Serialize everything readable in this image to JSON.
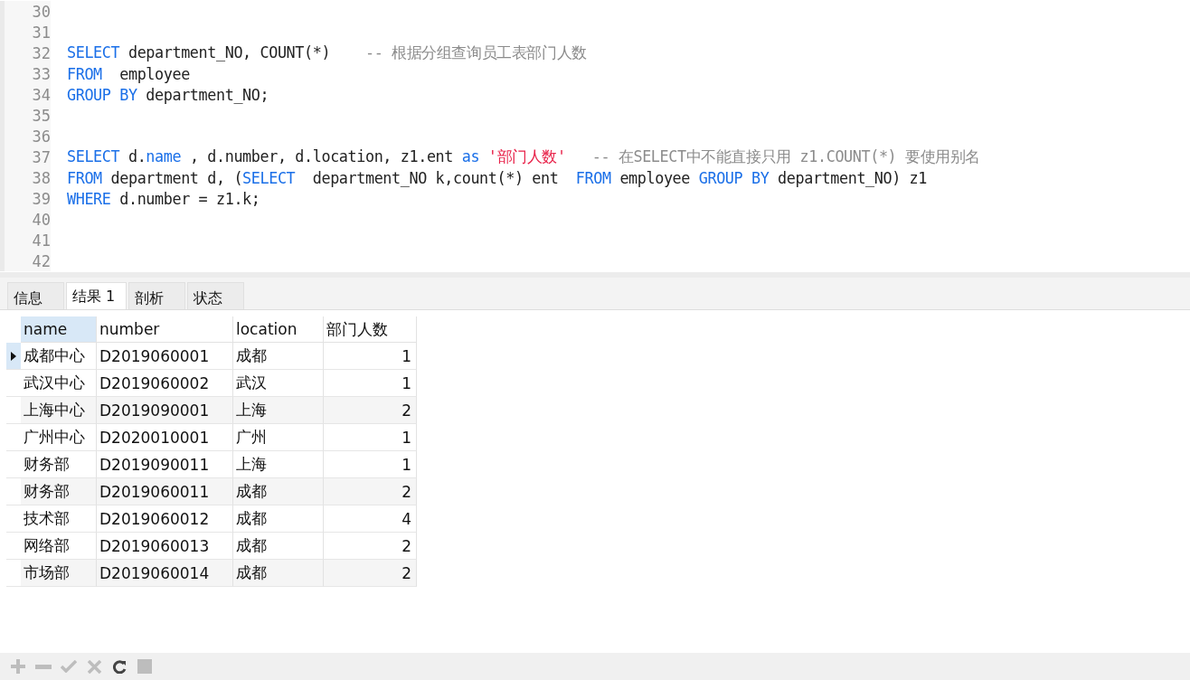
{
  "editor": {
    "lines": [
      {
        "number": "30"
      },
      {
        "number": "31"
      },
      {
        "number": "32",
        "tokens": [
          {
            "kind": "keyword",
            "text": "SELECT"
          },
          {
            "kind": "plain",
            "text": " department_NO, COUNT(*)    "
          },
          {
            "kind": "comment",
            "text": "-- 根据分组查询员工表部门人数"
          }
        ]
      },
      {
        "number": "33",
        "tokens": [
          {
            "kind": "keyword",
            "text": "FROM"
          },
          {
            "kind": "plain",
            "text": "  employee"
          }
        ]
      },
      {
        "number": "34",
        "tokens": [
          {
            "kind": "keyword",
            "text": "GROUP BY"
          },
          {
            "kind": "plain",
            "text": " department_NO;"
          }
        ]
      },
      {
        "number": "35"
      },
      {
        "number": "36"
      },
      {
        "number": "37",
        "tokens": [
          {
            "kind": "keyword",
            "text": "SELECT"
          },
          {
            "kind": "plain",
            "text": " d."
          },
          {
            "kind": "keyword",
            "text": "name"
          },
          {
            "kind": "plain",
            "text": " , d.number, d.location, z1.ent "
          },
          {
            "kind": "keyword",
            "text": "as"
          },
          {
            "kind": "string",
            "text": " '部门人数'"
          },
          {
            "kind": "comment",
            "text": "   -- 在SELECT中不能直接只用 z1.COUNT(*) 要使用别名"
          }
        ]
      },
      {
        "number": "38",
        "tokens": [
          {
            "kind": "keyword",
            "text": "FROM"
          },
          {
            "kind": "plain",
            "text": " department d, ("
          },
          {
            "kind": "keyword",
            "text": "SELECT"
          },
          {
            "kind": "plain",
            "text": "  department_NO k,count(*) ent  "
          },
          {
            "kind": "keyword",
            "text": "FROM"
          },
          {
            "kind": "plain",
            "text": " employee "
          },
          {
            "kind": "keyword",
            "text": "GROUP BY"
          },
          {
            "kind": "plain",
            "text": " department_NO) z1"
          }
        ]
      },
      {
        "number": "39",
        "tokens": [
          {
            "kind": "keyword",
            "text": "WHERE"
          },
          {
            "kind": "plain",
            "text": " d.number = z1.k;"
          }
        ]
      },
      {
        "number": "40"
      },
      {
        "number": "41"
      },
      {
        "number": "42"
      }
    ]
  },
  "tabs": [
    {
      "label": "信息",
      "selected": false
    },
    {
      "label": "结果 1",
      "selected": true
    },
    {
      "label": "剖析",
      "selected": false
    },
    {
      "label": "状态",
      "selected": false
    }
  ],
  "grid": {
    "columns": [
      {
        "label": "name",
        "kind": "text",
        "selected": true
      },
      {
        "label": "number",
        "kind": "text",
        "selected": false
      },
      {
        "label": "location",
        "kind": "text",
        "selected": false
      },
      {
        "label": "部门人数",
        "kind": "numeric",
        "selected": false
      }
    ],
    "rows": [
      {
        "current": true,
        "cells": [
          "成都中心",
          "D2019060001",
          "成都",
          "1"
        ]
      },
      {
        "current": false,
        "cells": [
          "武汉中心",
          "D2019060002",
          "武汉",
          "1"
        ]
      },
      {
        "current": false,
        "cells": [
          "上海中心",
          "D2019090001",
          "上海",
          "2"
        ]
      },
      {
        "current": false,
        "cells": [
          "广州中心",
          "D2020010001",
          "广州",
          "1"
        ]
      },
      {
        "current": false,
        "cells": [
          "财务部",
          "D2019090011",
          "上海",
          "1"
        ]
      },
      {
        "current": false,
        "cells": [
          "财务部",
          "D2019060011",
          "成都",
          "2"
        ]
      },
      {
        "current": false,
        "cells": [
          "技术部",
          "D2019060012",
          "成都",
          "4"
        ]
      },
      {
        "current": false,
        "cells": [
          "网络部",
          "D2019060013",
          "成都",
          "2"
        ]
      },
      {
        "current": false,
        "cells": [
          "市场部",
          "D2019060014",
          "成都",
          "2"
        ]
      }
    ]
  },
  "toolbar": [
    {
      "kind": "add",
      "disabled": true
    },
    {
      "kind": "delete",
      "disabled": true
    },
    {
      "kind": "apply",
      "disabled": true
    },
    {
      "kind": "discard",
      "disabled": true
    },
    {
      "kind": "refresh",
      "disabled": false
    },
    {
      "kind": "stop",
      "disabled": true
    }
  ]
}
